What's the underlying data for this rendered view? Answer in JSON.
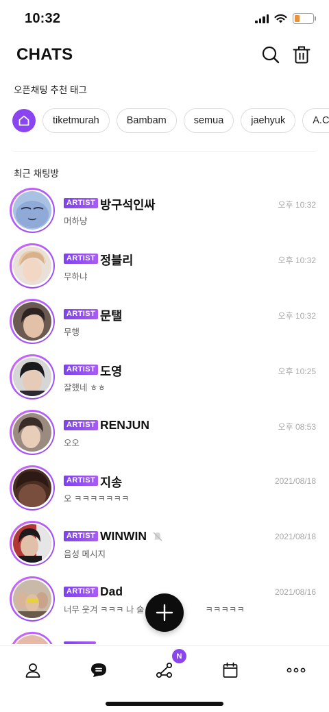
{
  "status_bar": {
    "time": "10:32",
    "battery_level": 0.28
  },
  "header": {
    "title": "CHATS",
    "search_icon": "search-icon",
    "delete_icon": "trash-icon"
  },
  "tags_section": {
    "label": "오픈채팅 추천 태그",
    "home_icon": "home-icon",
    "tags": [
      "tiketmurah",
      "Bambam",
      "semua",
      "jaehyuk",
      "A.C."
    ]
  },
  "recent_section": {
    "label": "최근 채팅방"
  },
  "chats": [
    {
      "badge": "ARTIST",
      "name": "방구석인싸",
      "message": "머하냥",
      "time": "오후 10:32"
    },
    {
      "badge": "ARTIST",
      "name": "정블리",
      "message": "무하냐",
      "time": "오후 10:32"
    },
    {
      "badge": "ARTIST",
      "name": "문탤",
      "message": "무행",
      "time": "오후 10:32"
    },
    {
      "badge": "ARTIST",
      "name": "도영",
      "message": "잘했네 ㅎㅎ",
      "time": "오후 10:25"
    },
    {
      "badge": "ARTIST",
      "name": "RENJUN",
      "message": "오오",
      "time": "오후 08:53"
    },
    {
      "badge": "ARTIST",
      "name": "지송",
      "message": "오 ㅋㅋㅋㅋㅋㅋㅋ",
      "time": "2021/08/18"
    },
    {
      "badge": "ARTIST",
      "name": "WINWIN",
      "message": "음성 메시지",
      "time": "2021/08/18",
      "muted": true
    },
    {
      "badge": "ARTIST",
      "name": "Dad",
      "message": "너무 웃겨 ㅋㅋㅋ 나 술",
      "message_tail": "ㅋㅋㅋㅋㅋ",
      "time": "2021/08/16"
    }
  ],
  "fab": {
    "icon": "plus-icon"
  },
  "tab_bar": {
    "items": [
      {
        "icon": "person-icon"
      },
      {
        "icon": "chat-bubble-icon",
        "active": true
      },
      {
        "icon": "share-network-icon",
        "badge": "N"
      },
      {
        "icon": "calendar-icon"
      },
      {
        "icon": "more-icon"
      }
    ]
  },
  "colors": {
    "accent": "#8a45f0",
    "badge_gradient_start": "#7d43ea",
    "badge_gradient_end": "#a95cf2",
    "fab": "#0d0d0d"
  }
}
